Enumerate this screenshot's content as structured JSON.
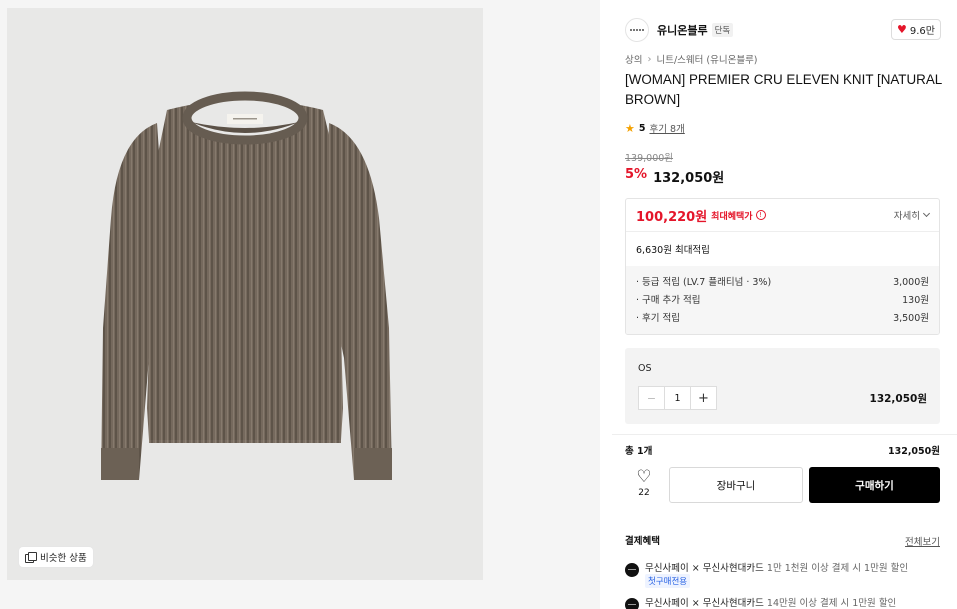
{
  "product_image": {
    "similar_label": "비슷한 상품",
    "sweater_color": "#75695d",
    "background_color": "#e8e8e7"
  },
  "brand": {
    "name": "유니온블루",
    "tag": "단독",
    "likes": "9.6만"
  },
  "breadcrumb": [
    "상의",
    "니트/스웨터 (유니온블루)"
  ],
  "product": {
    "title": "[WOMAN] PREMIER CRU ELEVEN KNIT [NATURAL BROWN]",
    "rating": "5",
    "reviews": "후기 8개",
    "original_price": "139,000원",
    "discount": "5%",
    "price": "132,050원"
  },
  "benefit": {
    "max_price": "100,220원",
    "max_label": "최대혜택가",
    "info_icon": "!",
    "detail_label": "자세히",
    "points_total": "6,630원 최대적립",
    "points": [
      {
        "label": "· 등급 적립 (LV.7 플래티넘 · 3%)",
        "value": "3,000원"
      },
      {
        "label": "· 구매 추가 적립",
        "value": "130원"
      },
      {
        "label": "· 후기 적립",
        "value": "3,500원"
      }
    ]
  },
  "option": {
    "name": "OS",
    "minus": "−",
    "quantity": "1",
    "plus": "+",
    "price": "132,050원"
  },
  "total": {
    "label": "총 1개",
    "value": "132,050원"
  },
  "actions": {
    "like_count": "22",
    "cart_label": "장바구니",
    "buy_label": "구매하기"
  },
  "payment": {
    "title": "결제혜택",
    "view_all": "전체보기",
    "items": [
      {
        "name": "무신사페이 × 무신사현대카드",
        "condition": "1만 1천원 이상 결제 시 1만원 할인",
        "tag": "첫구매전용"
      },
      {
        "name": "무신사페이 × 무신사현대카드",
        "condition": "14만원 이상 결제 시 1만원 할인"
      }
    ]
  },
  "colors": {
    "accent_red": "#e4152a",
    "buy_button": "#000000",
    "star": "#f4a100"
  }
}
